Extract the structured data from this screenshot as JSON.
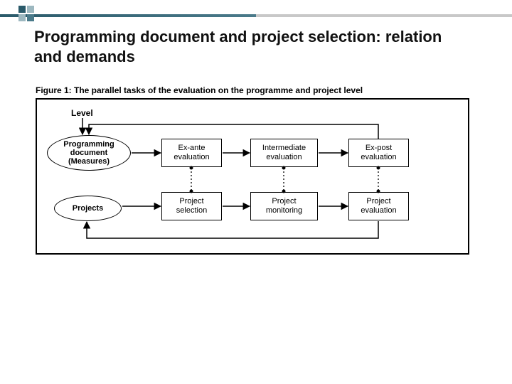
{
  "slide": {
    "title": "Programming document and project selection: relation and demands"
  },
  "figure": {
    "caption": "Figure 1: The parallel tasks of the evaluation on the programme and project level",
    "level_label": "Level",
    "row1": {
      "level": {
        "l1": "Programming",
        "l2": "document",
        "l3": "(Measures)"
      },
      "b1": {
        "l1": "Ex-ante",
        "l2": "evaluation"
      },
      "b2": {
        "l1": "Intermediate",
        "l2": "evaluation"
      },
      "b3": {
        "l1": "Ex-post",
        "l2": "evaluation"
      }
    },
    "row2": {
      "level": "Projects",
      "b1": {
        "l1": "Project",
        "l2": "selection"
      },
      "b2": {
        "l1": "Project",
        "l2": "monitoring"
      },
      "b3": {
        "l1": "Project",
        "l2": "evaluation"
      }
    }
  }
}
